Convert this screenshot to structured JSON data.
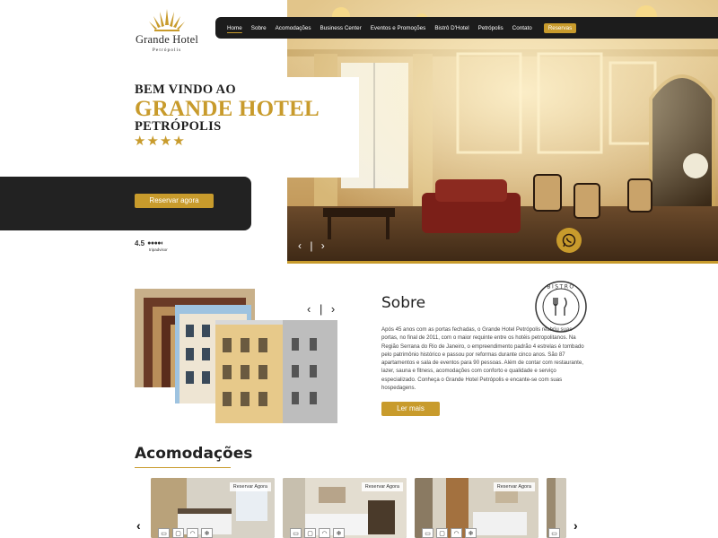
{
  "brand": {
    "name": "Grande Hotel",
    "subname": "Petrópolis",
    "accent": "#c89b2c",
    "dark": "#1c1c1c"
  },
  "nav": {
    "items": [
      "Home",
      "Sobre",
      "Acomodações",
      "Business Center",
      "Eventos e Promoções",
      "Bistrô D'Hotel",
      "Petrópolis",
      "Contato"
    ],
    "active": "Home",
    "cta": "Reservas"
  },
  "hero": {
    "line1": "BEM VINDO AO",
    "line2": "GRANDE HOTEL",
    "line3": "PETRÓPOLIS",
    "stars": "★★★★",
    "star_rating": 4,
    "cta": "Reservar agora",
    "rating_value": "4.5",
    "rating_dots": "●●●●◐",
    "rating_source": "tripadvisor",
    "slider_arrows": "‹ | ›",
    "whatsapp_icon": "whatsapp-icon"
  },
  "about": {
    "title": "Sobre",
    "text": "Após 45 anos com as portas fechadas, o Grande Hotel Petrópolis reabriu suas portas, no final de 2011, com o maior requinte entre os hotéis petropolitanos. Na Região Serrana do Rio de Janeiro, o empreendimento padrão 4 estrelas é tombado pelo patrimônio histórico e passou por reformas durante cinco anos. São 87 apartamentos e sala de eventos para 90 pessoas. Além de contar com restaurante, lazer, sauna e fitness, acomodações com conforto e qualidade e serviço especializado. Conheça o Grande Hotel Petrópolis e encante-se com suas hospedagens.",
    "cta": "Ler mais",
    "slider_arrows": "‹ | ›",
    "badge_text": "BISTRÔ"
  },
  "rooms": {
    "title": "Acomodações",
    "card_cta": "Reservar Agora",
    "cards": [
      {
        "cta": "Reservar Agora"
      },
      {
        "cta": "Reservar Agora"
      },
      {
        "cta": "Reservar Agora"
      }
    ],
    "prev": "‹",
    "next": "›"
  }
}
